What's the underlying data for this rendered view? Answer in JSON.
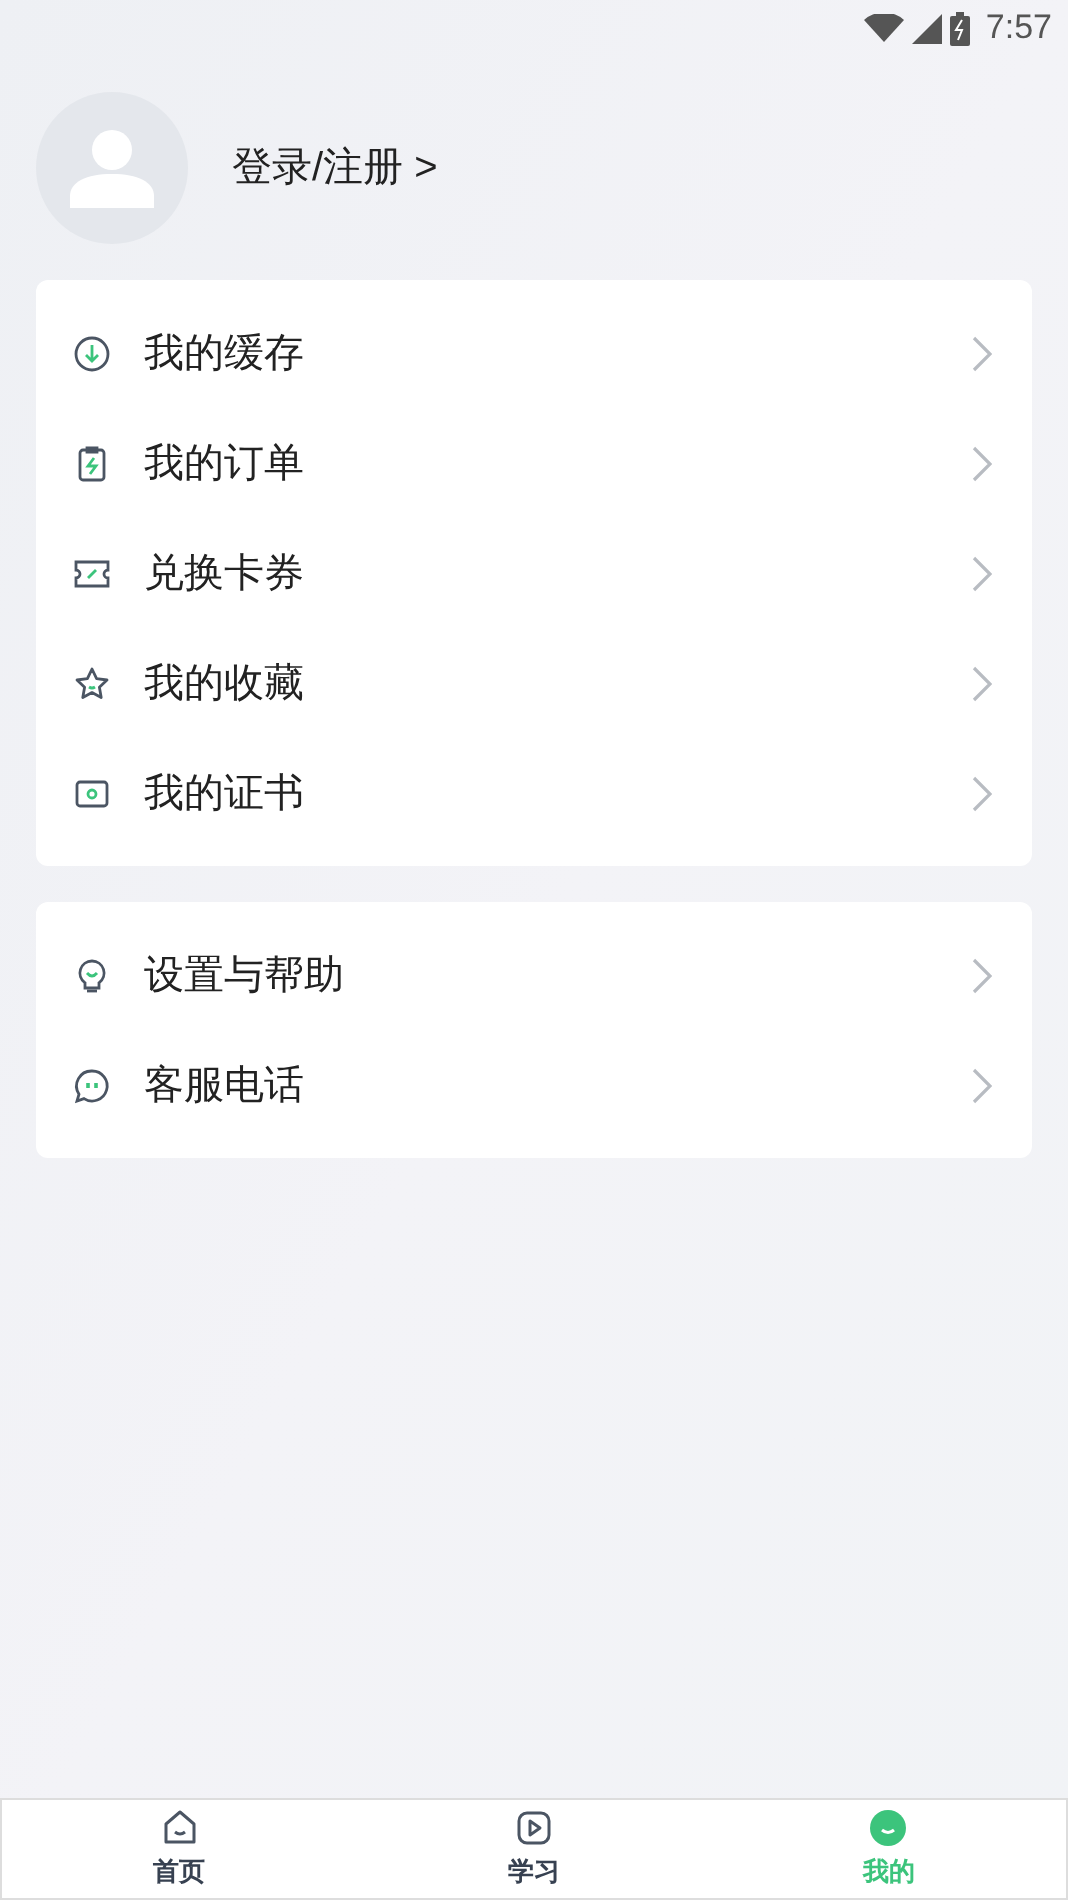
{
  "status_bar": {
    "time": "7:57"
  },
  "profile": {
    "login_label": "登录/注册 >"
  },
  "menu_groups": [
    {
      "items": [
        {
          "kind": "download",
          "label": "我的缓存"
        },
        {
          "kind": "order",
          "label": "我的订单"
        },
        {
          "kind": "ticket",
          "label": "兑换卡券"
        },
        {
          "kind": "star",
          "label": "我的收藏"
        },
        {
          "kind": "certificate",
          "label": "我的证书"
        }
      ]
    },
    {
      "items": [
        {
          "kind": "bulb",
          "label": "设置与帮助"
        },
        {
          "kind": "chat",
          "label": "客服电话"
        }
      ]
    }
  ],
  "bottom_nav": [
    {
      "kind": "home",
      "label": "首页",
      "selected": false
    },
    {
      "kind": "play",
      "label": "学习",
      "selected": false
    },
    {
      "kind": "me",
      "label": "我的",
      "selected": true
    }
  ]
}
